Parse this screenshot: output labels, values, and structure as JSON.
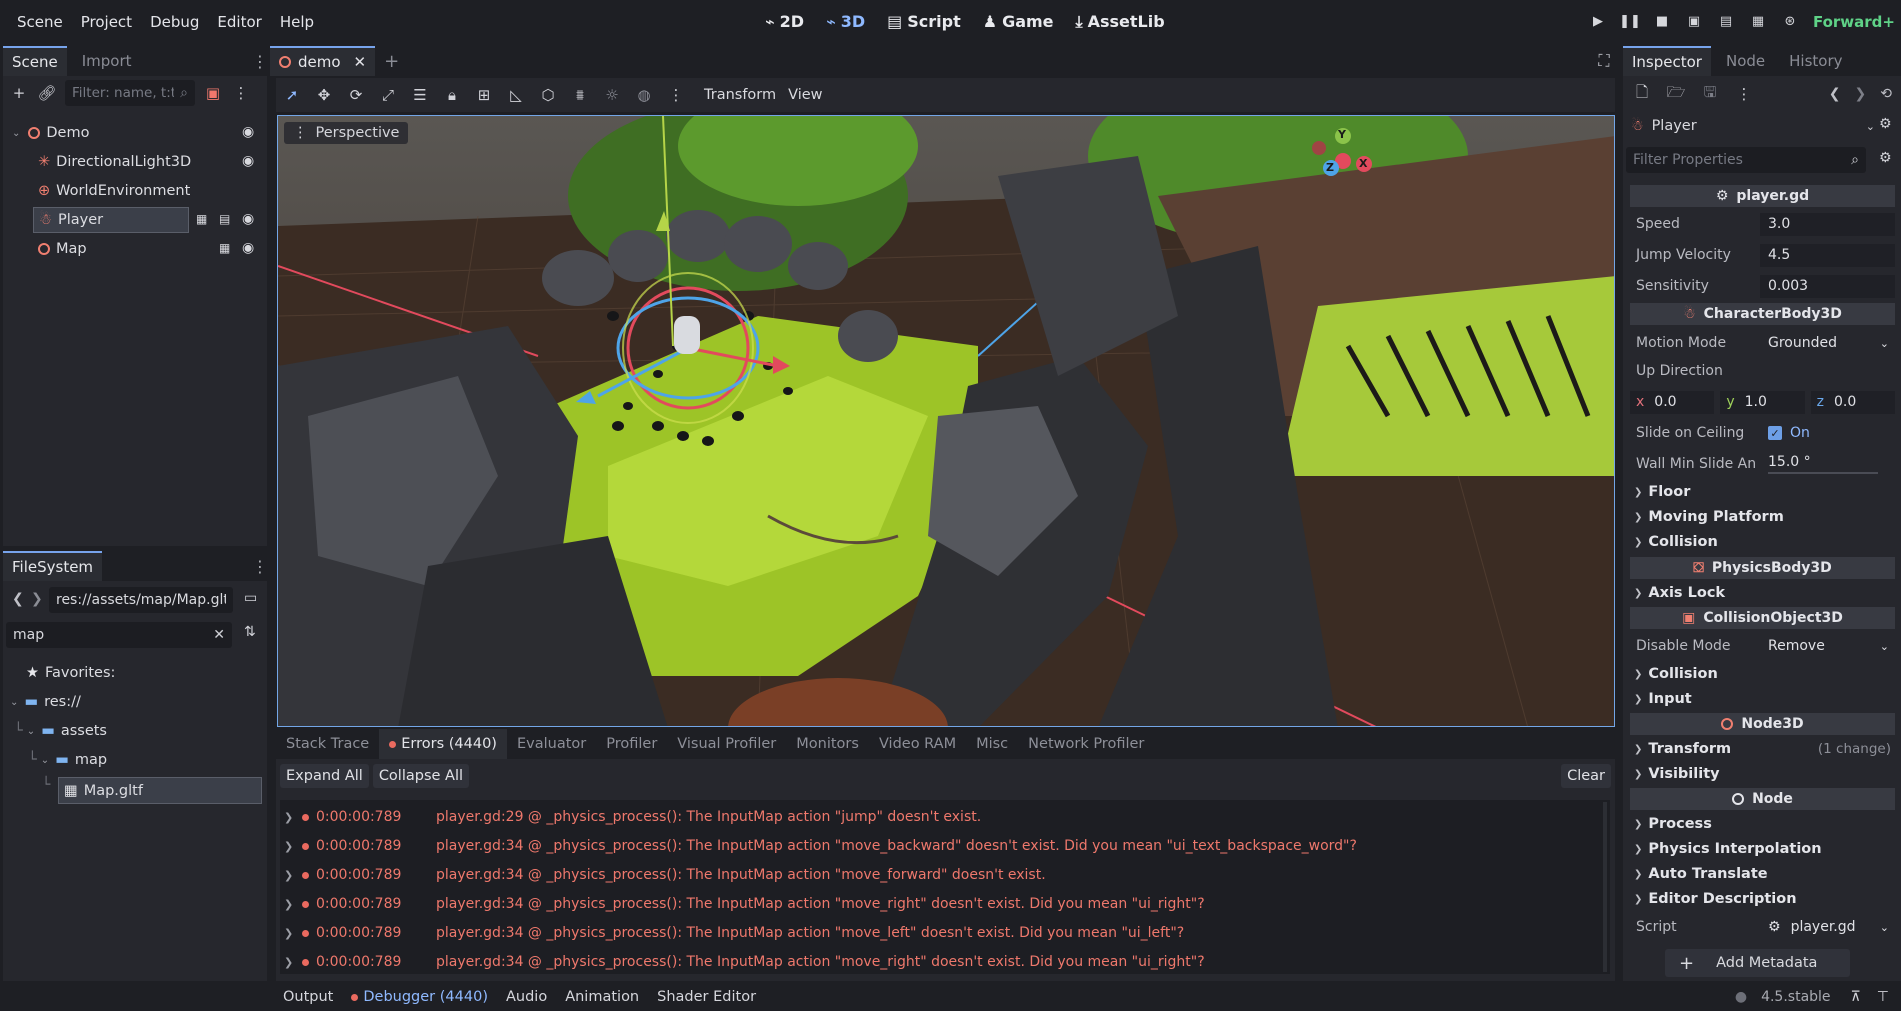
{
  "menu": [
    "Scene",
    "Project",
    "Debug",
    "Editor",
    "Help"
  ],
  "workspaces": [
    {
      "label": "2D",
      "icon": "2d-icon"
    },
    {
      "label": "3D",
      "icon": "3d-icon",
      "active": true
    },
    {
      "label": "Script",
      "icon": "script-icon"
    },
    {
      "label": "Game",
      "icon": "game-icon"
    },
    {
      "label": "AssetLib",
      "icon": "assetlib-icon"
    }
  ],
  "renderer": "Forward+",
  "scene_dock": {
    "tabs": [
      "Scene",
      "Import"
    ],
    "filter_placeholder": "Filter: name, t:t",
    "nodes": [
      {
        "name": "Demo",
        "icon": "node3d-icon"
      },
      {
        "name": "DirectionalLight3D",
        "icon": "light-icon"
      },
      {
        "name": "WorldEnvironment",
        "icon": "globe-icon"
      },
      {
        "name": "Player",
        "icon": "character-icon",
        "selected": true
      },
      {
        "name": "Map",
        "icon": "node3d-icon"
      }
    ]
  },
  "filesystem": {
    "title": "FileSystem",
    "path": "res://assets/map/Map.gltf",
    "search_value": "map",
    "favorites": "Favorites:",
    "items": [
      {
        "label": "res://"
      },
      {
        "label": "assets"
      },
      {
        "label": "map"
      },
      {
        "label": "Map.gltf",
        "selected": true
      }
    ]
  },
  "editor_tabs": {
    "active": "demo"
  },
  "viewport_toolbar": {
    "transform": "Transform",
    "view": "View"
  },
  "viewport": {
    "perspective_label": "Perspective",
    "gizmo": {
      "x": "X",
      "y": "Y",
      "z": "Z"
    }
  },
  "debugger": {
    "tabs": [
      "Stack Trace",
      "Errors (4440)",
      "Evaluator",
      "Profiler",
      "Visual Profiler",
      "Monitors",
      "Video RAM",
      "Misc",
      "Network Profiler"
    ],
    "expand_all": "Expand All",
    "collapse_all": "Collapse All",
    "clear": "Clear",
    "errors": [
      {
        "time": "0:00:00:789",
        "msg": "player.gd:29 @ _physics_process(): The InputMap action \"jump\" doesn't exist."
      },
      {
        "time": "0:00:00:789",
        "msg": "player.gd:34 @ _physics_process(): The InputMap action \"move_backward\" doesn't exist. Did you mean \"ui_text_backspace_word\"?"
      },
      {
        "time": "0:00:00:789",
        "msg": "player.gd:34 @ _physics_process(): The InputMap action \"move_forward\" doesn't exist."
      },
      {
        "time": "0:00:00:789",
        "msg": "player.gd:34 @ _physics_process(): The InputMap action \"move_right\" doesn't exist. Did you mean \"ui_right\"?"
      },
      {
        "time": "0:00:00:789",
        "msg": "player.gd:34 @ _physics_process(): The InputMap action \"move_left\" doesn't exist. Did you mean \"ui_left\"?"
      },
      {
        "time": "0:00:00:789",
        "msg": "player.gd:34 @ _physics_process(): The InputMap action \"move_right\" doesn't exist. Did you mean \"ui_right\"?"
      }
    ]
  },
  "bottom_tabs": [
    "Output",
    "Debugger (4440)",
    "Audio",
    "Animation",
    "Shader Editor"
  ],
  "version": "4.5.stable",
  "inspector": {
    "tabs": [
      "Inspector",
      "Node",
      "History"
    ],
    "object": "Player",
    "filter_placeholder": "Filter Properties",
    "script_header": "player.gd",
    "speed_label": "Speed",
    "speed": "3.0",
    "jump_label": "Jump Velocity",
    "jump": "4.5",
    "sens_label": "Sensitivity",
    "sens": "0.003",
    "char_header": "CharacterBody3D",
    "motion_label": "Motion Mode",
    "motion": "Grounded",
    "up_label": "Up Direction",
    "up_x": "0.0",
    "up_y": "1.0",
    "up_z": "0.0",
    "slide_label": "Slide on Ceiling",
    "slide": "On",
    "wall_label": "Wall Min Slide An",
    "wall": "15.0 °",
    "floor": "Floor",
    "moving": "Moving Platform",
    "collision1": "Collision",
    "phys_header": "PhysicsBody3D",
    "axis_lock": "Axis Lock",
    "colobj_header": "CollisionObject3D",
    "disable_label": "Disable Mode",
    "disable": "Remove",
    "collision2": "Collision",
    "input": "Input",
    "node3d_header": "Node3D",
    "transform": "Transform",
    "transform_note": "(1 change)",
    "visibility": "Visibility",
    "node_header": "Node",
    "process": "Process",
    "phys_interp": "Physics Interpolation",
    "auto_translate": "Auto Translate",
    "editor_desc": "Editor Description",
    "script_label": "Script",
    "script_value": "player.gd",
    "add_metadata": "Add Metadata"
  }
}
